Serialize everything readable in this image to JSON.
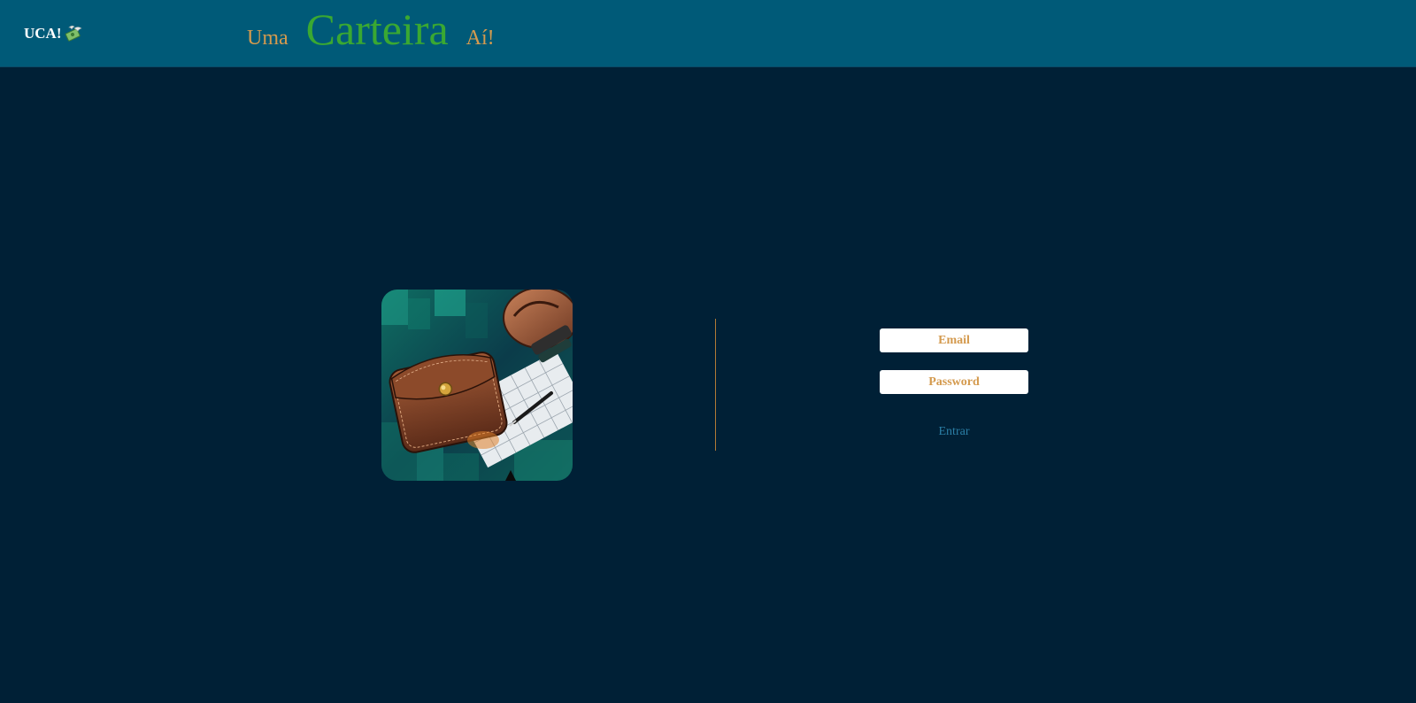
{
  "header": {
    "brand": "UCA!",
    "brand_icon": "money-with-wings-icon",
    "tagline": {
      "word1": "Uma",
      "word2": "Carteira",
      "word3": "Aí!"
    }
  },
  "colors": {
    "header_bg": "#005a78",
    "page_bg": "#002036",
    "accent_orange": "#d49a4e",
    "accent_green": "#3aa832",
    "link_blue": "#2b7fa6"
  },
  "login": {
    "email_placeholder": "Email",
    "password_placeholder": "Password",
    "submit_label": "Entrar"
  },
  "illustration": {
    "icon": "wallet-illustration-icon"
  }
}
